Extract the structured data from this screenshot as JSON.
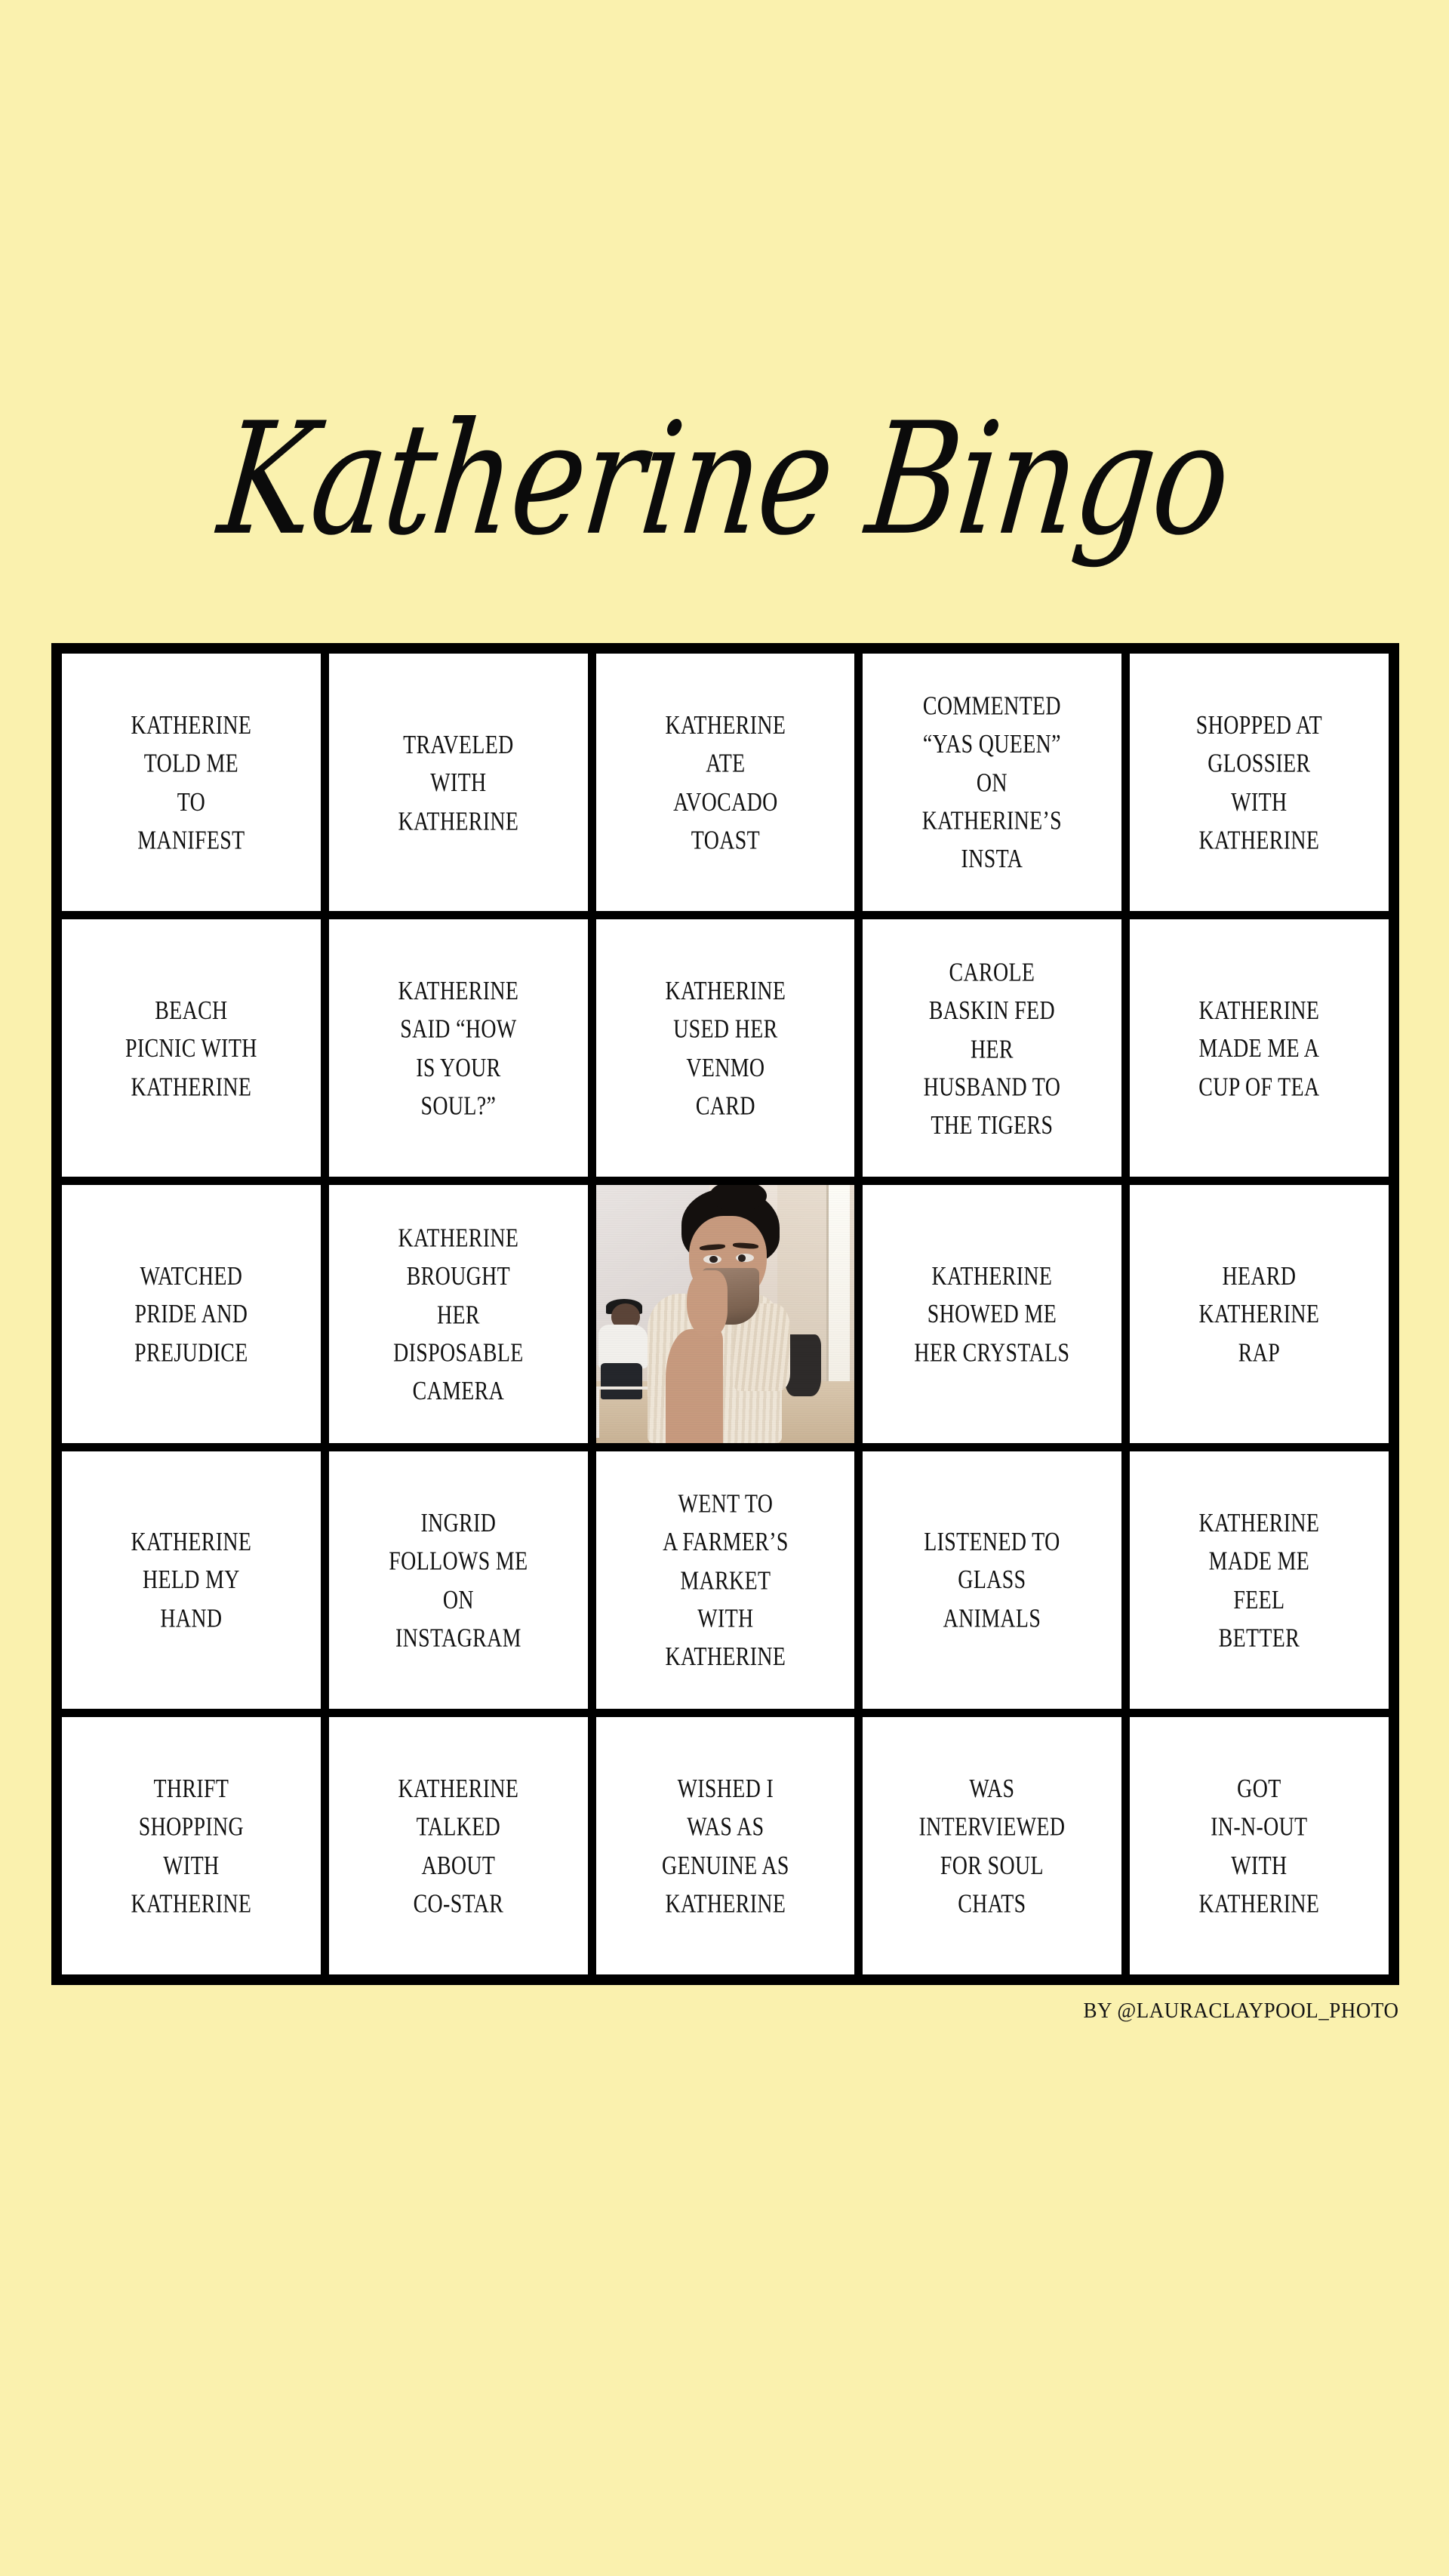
{
  "page": {
    "background_color": "#faf1ae",
    "title": "Katherine Bingo",
    "credit": "BY @LAURACLAYPOOL_PHOTO"
  },
  "board": {
    "border_color": "#000000",
    "cell_background": "#ffffff",
    "rows": 5,
    "columns": 5,
    "cells": [
      {
        "id": "r1c1",
        "text": "KATHERINE\nTOLD ME\nTO\nMANIFEST",
        "type": "text"
      },
      {
        "id": "r1c2",
        "text": "TRAVELED\nWITH\nKATHERINE",
        "type": "text"
      },
      {
        "id": "r1c3",
        "text": "KATHERINE\nATE\nAVOCADO\nTOAST",
        "type": "text"
      },
      {
        "id": "r1c4",
        "text": "COMMENTED\n“YAS QUEEN”\nON\nKATHERINE’S\nINSTA",
        "type": "text"
      },
      {
        "id": "r1c5",
        "text": "SHOPPED AT\nGLOSSIER\nWITH\nKATHERINE",
        "type": "text"
      },
      {
        "id": "r2c1",
        "text": "BEACH\nPICNIC WITH\nKATHERINE",
        "type": "text"
      },
      {
        "id": "r2c2",
        "text": "KATHERINE\nSAID “HOW\nIS YOUR\nSOUL?”",
        "type": "text"
      },
      {
        "id": "r2c3",
        "text": "KATHERINE\nUSED HER\nVENMO\nCARD",
        "type": "text"
      },
      {
        "id": "r2c4",
        "text": "CAROLE\nBASKIN FED\nHER\nHUSBAND TO\nTHE TIGERS",
        "type": "text"
      },
      {
        "id": "r2c5",
        "text": "KATHERINE\nMADE ME A\nCUP OF TEA",
        "type": "text"
      },
      {
        "id": "r3c1",
        "text": "WATCHED\nPRIDE AND\nPREJUDICE",
        "type": "text"
      },
      {
        "id": "r3c2",
        "text": "KATHERINE\nBROUGHT\nHER\nDISPOSABLE\nCAMERA",
        "type": "text"
      },
      {
        "id": "r3c3",
        "text": "",
        "type": "photo",
        "photo_description": "Woman with dark curly hair in a bun drinking from a brown mug in a cafe"
      },
      {
        "id": "r3c4",
        "text": "KATHERINE\nSHOWED ME\nHER CRYSTALS",
        "type": "text"
      },
      {
        "id": "r3c5",
        "text": "HEARD\nKATHERINE\nRAP",
        "type": "text"
      },
      {
        "id": "r4c1",
        "text": "KATHERINE\nHELD MY\nHAND",
        "type": "text"
      },
      {
        "id": "r4c2",
        "text": "INGRID\nFOLLOWS ME\nON\nINSTAGRAM",
        "type": "text"
      },
      {
        "id": "r4c3",
        "text": "WENT TO\nA FARMER’S\nMARKET\nWITH\nKATHERINE",
        "type": "text"
      },
      {
        "id": "r4c4",
        "text": "LISTENED TO\nGLASS\nANIMALS",
        "type": "text"
      },
      {
        "id": "r4c5",
        "text": "KATHERINE\nMADE ME\nFEEL\nBETTER",
        "type": "text"
      },
      {
        "id": "r5c1",
        "text": "THRIFT\nSHOPPING\nWITH\nKATHERINE",
        "type": "text"
      },
      {
        "id": "r5c2",
        "text": "KATHERINE\nTALKED\nABOUT\nCO-STAR",
        "type": "text"
      },
      {
        "id": "r5c3",
        "text": "WISHED I\nWAS AS\nGENUINE AS\nKATHERINE",
        "type": "text"
      },
      {
        "id": "r5c4",
        "text": "WAS\nINTERVIEWED\nFOR SOUL\nCHATS",
        "type": "text"
      },
      {
        "id": "r5c5",
        "text": "GOT\nIN-N-OUT\nWITH\nKATHERINE",
        "type": "text"
      }
    ]
  }
}
